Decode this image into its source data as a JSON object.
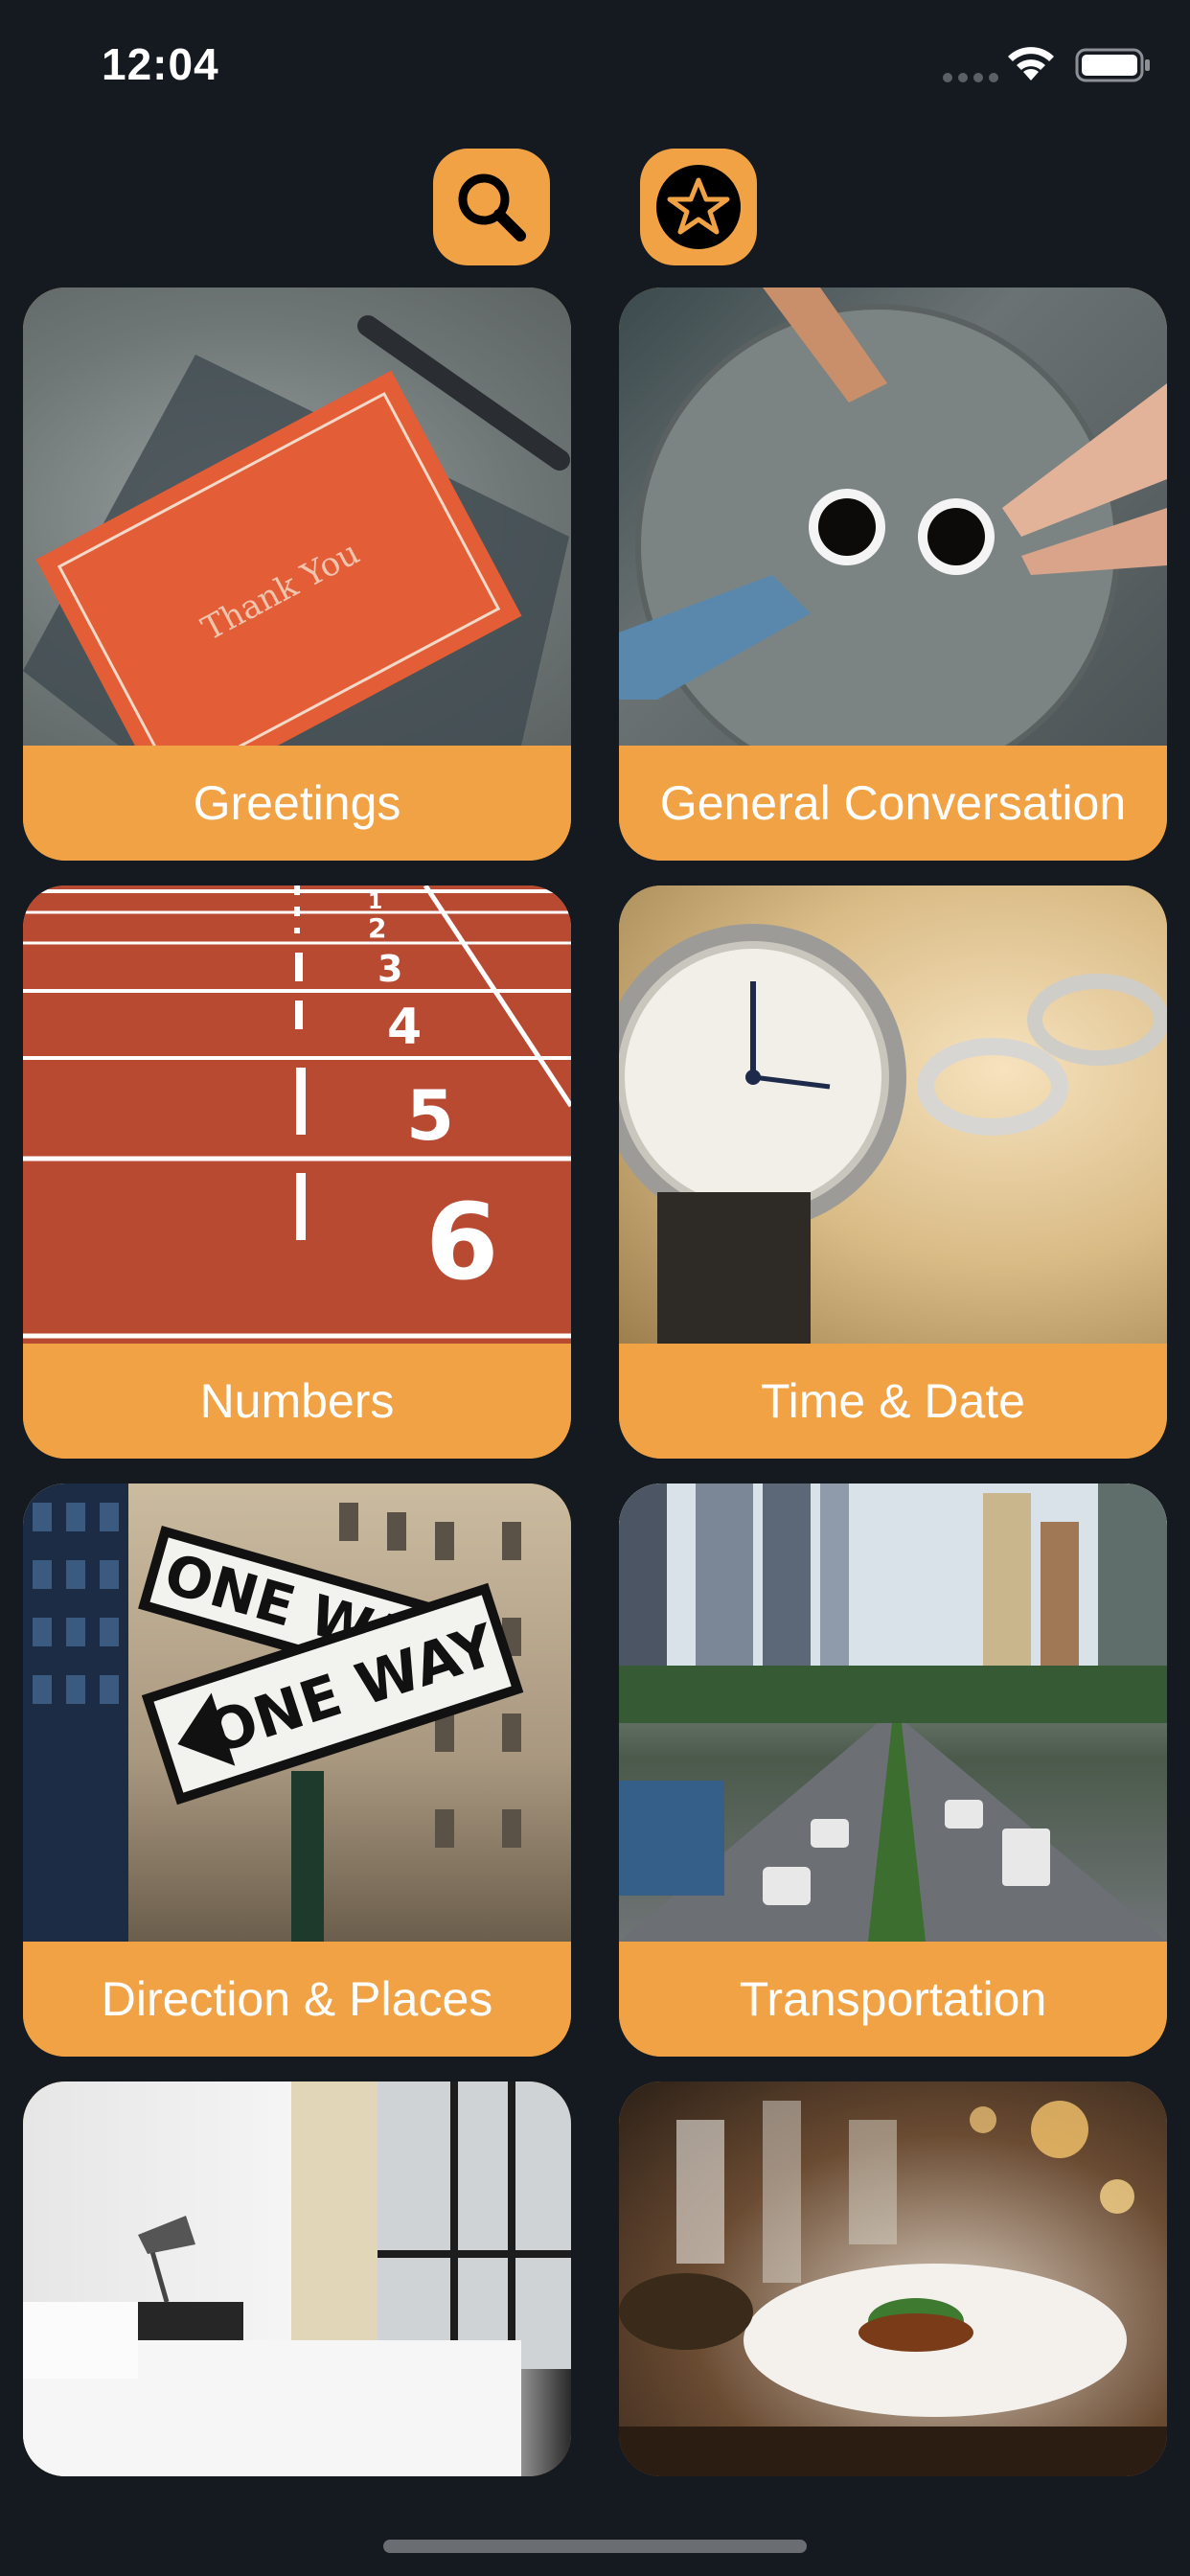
{
  "status_bar": {
    "time": "12:04"
  },
  "header": {
    "search_icon": "search-icon",
    "favorites_icon": "star-icon",
    "accent_color": "#f0a245"
  },
  "categories": [
    {
      "label": "Greetings",
      "image": "thank-you-card-photo"
    },
    {
      "label": "General Conversation",
      "image": "coffee-table-photo"
    },
    {
      "label": "Numbers",
      "image": "running-track-lanes-photo"
    },
    {
      "label": "Time & Date",
      "image": "watch-and-rings-photo"
    },
    {
      "label": "Direction & Places",
      "image": "one-way-street-signs-photo"
    },
    {
      "label": "Transportation",
      "image": "city-traffic-photo"
    },
    {
      "label": "",
      "image": "hotel-room-photo"
    },
    {
      "label": "",
      "image": "restaurant-table-photo"
    }
  ],
  "photo_text": {
    "card_text": "Thank You",
    "sign_text": "ONE WAY",
    "lane_numbers": [
      "1",
      "2",
      "3",
      "4",
      "5",
      "6"
    ]
  }
}
